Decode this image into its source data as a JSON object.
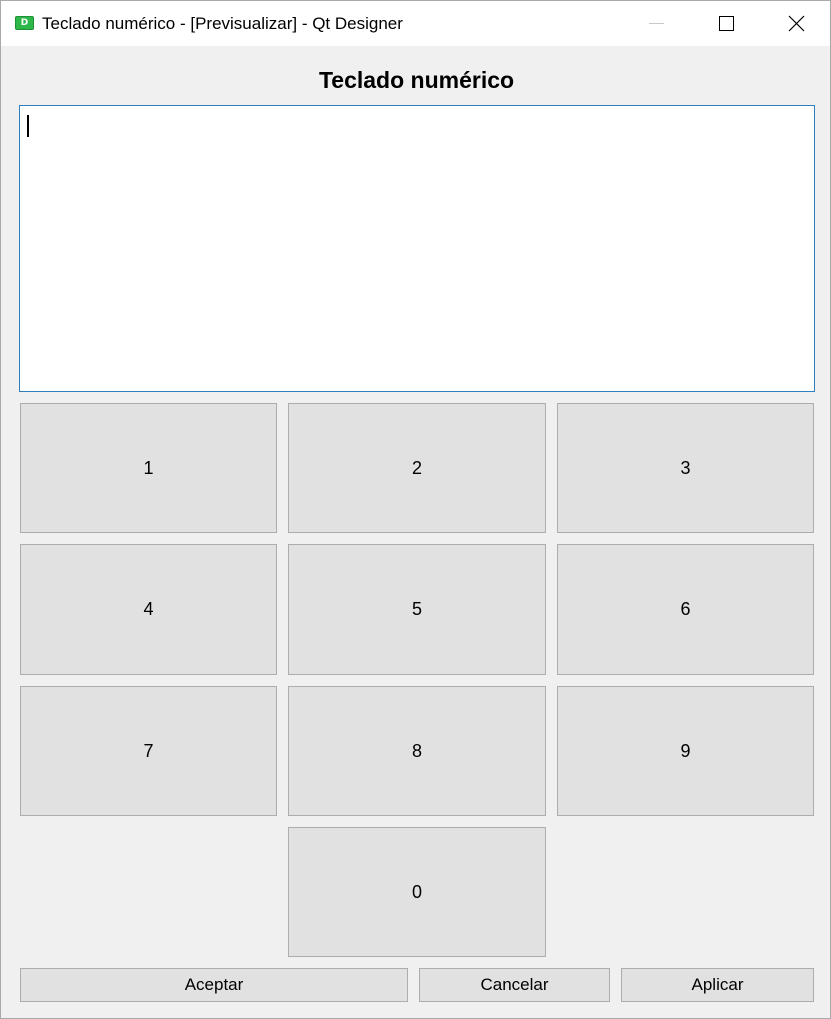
{
  "window": {
    "title": "Teclado numérico - [Previsualizar] - Qt Designer",
    "icon_label": "D",
    "controls": {
      "minimize": "minimize-icon",
      "maximize": "maximize-icon",
      "close": "close-icon"
    }
  },
  "dialog": {
    "heading": "Teclado numérico",
    "input_value": ""
  },
  "keypad": {
    "keys": [
      "1",
      "2",
      "3",
      "4",
      "5",
      "6",
      "7",
      "8",
      "9",
      "0"
    ]
  },
  "actions": {
    "accept_label": "Aceptar",
    "cancel_label": "Cancelar",
    "apply_label": "Aplicar"
  },
  "colors": {
    "app_icon": "#2fb84a",
    "focus_border": "#2f7fbf",
    "button_face": "#e1e1e1",
    "window_bg": "#f0f0f0"
  }
}
